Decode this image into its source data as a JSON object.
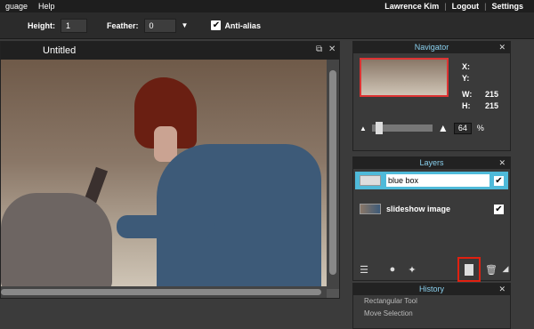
{
  "menubar": {
    "items": [
      "guage",
      "Help"
    ],
    "user": "Lawrence Kim",
    "sep1": "|",
    "logout": "Logout",
    "sep2": "|",
    "settings": "Settings"
  },
  "options": {
    "height_label": "Height:",
    "height_value": "1",
    "feather_label": "Feather:",
    "feather_value": "0",
    "antialias_label": "Anti-alias",
    "antialias_checked": "✔"
  },
  "canvas": {
    "title": "Untitled",
    "restore_icon": "⧉",
    "close_icon": "✕"
  },
  "navigator": {
    "title": "Navigator",
    "close": "✕",
    "x_label": "X:",
    "y_label": "Y:",
    "w_label": "W:",
    "w_value": "215",
    "h_label": "H:",
    "h_value": "215",
    "zoom_value": "64",
    "zoom_unit": "%"
  },
  "layers": {
    "title": "Layers",
    "close": "✕",
    "items": [
      {
        "name": "blue box",
        "checked": "✔"
      },
      {
        "name": "slideshow image",
        "checked": "✔"
      }
    ]
  },
  "history": {
    "title": "History",
    "close": "✕",
    "items": [
      "Rectangular Tool",
      "Move Selection"
    ]
  }
}
